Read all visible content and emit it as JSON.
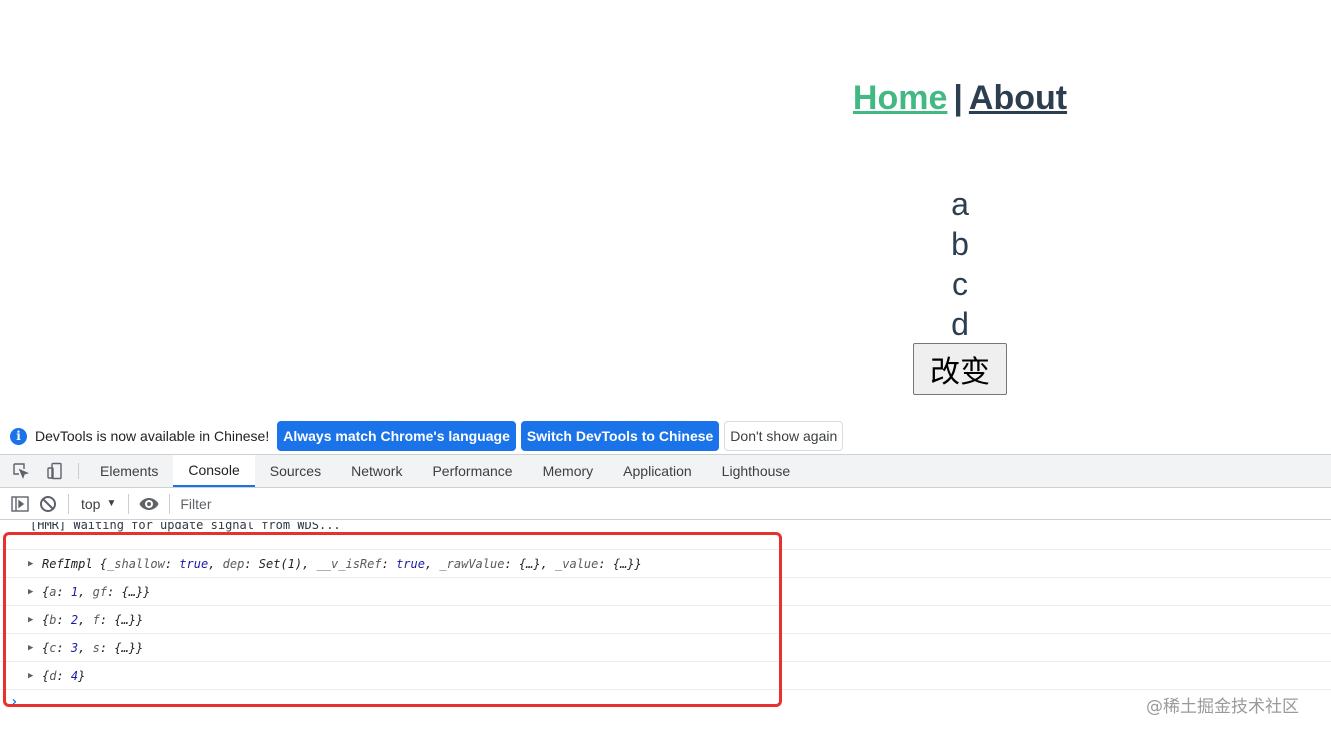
{
  "app": {
    "nav": {
      "home": "Home",
      "separator": "|",
      "about": "About"
    },
    "letters": [
      "a",
      "b",
      "c",
      "d"
    ],
    "button_label": "改变"
  },
  "devtools": {
    "infobar": {
      "message": "DevTools is now available in Chinese!",
      "always_match": "Always match Chrome's language",
      "switch_chinese": "Switch DevTools to Chinese",
      "dont_show": "Don't show again"
    },
    "tabs": [
      "Elements",
      "Console",
      "Sources",
      "Network",
      "Performance",
      "Memory",
      "Application",
      "Lighthouse"
    ],
    "active_tab": "Console",
    "toolbar": {
      "context": "top",
      "filter_placeholder": "Filter"
    },
    "console": {
      "hmr_message": "[HMR] Waiting for update signal from WDS...",
      "prompt": "›"
    }
  },
  "watermark": "@稀土掘金技术社区",
  "colors": {
    "active_link": "#42b983",
    "text": "#2c3e50",
    "highlight": "#e8302e",
    "primary_button": "#1a73e8"
  }
}
